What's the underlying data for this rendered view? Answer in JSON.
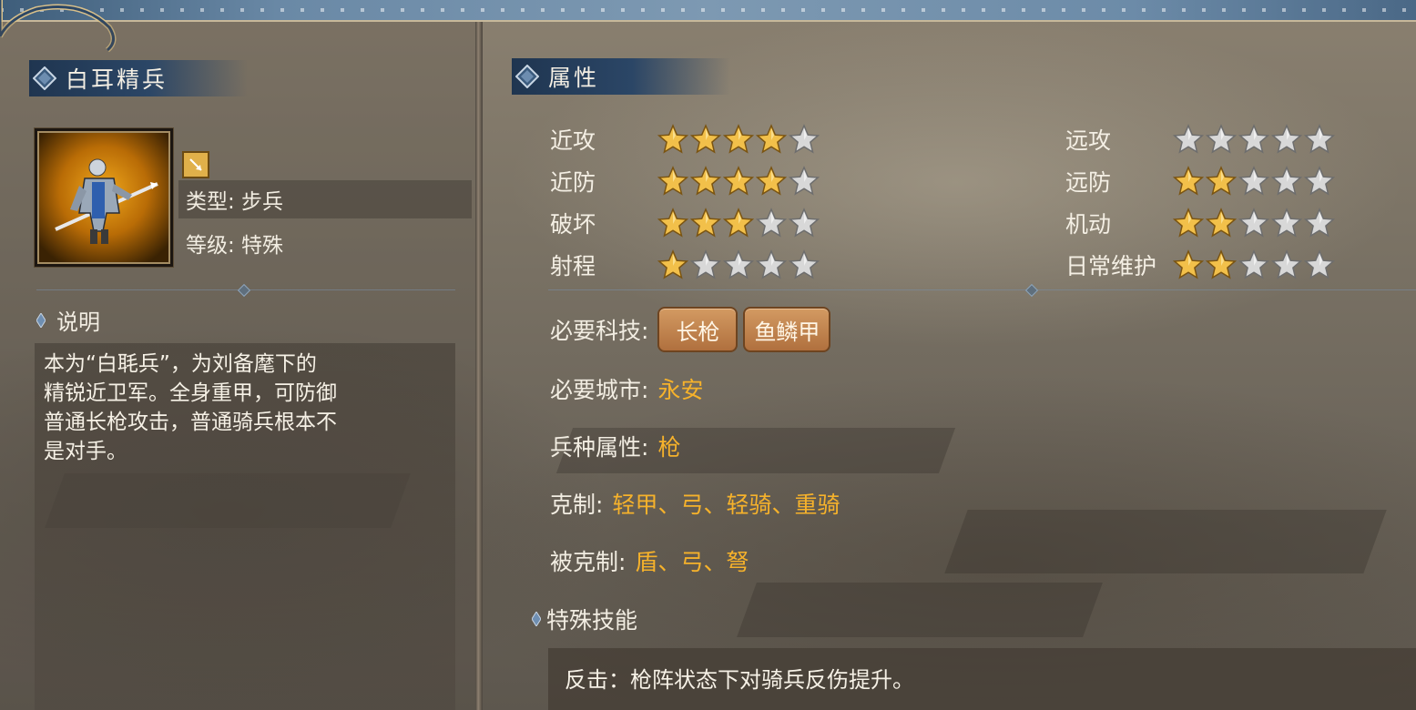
{
  "unit": {
    "name": "白耳精兵",
    "type_label": "类型: 步兵",
    "level_label": "等级: 特殊"
  },
  "description": {
    "heading": "说明",
    "lines": [
      "本为“白毦兵”，为刘备麾下的",
      "精锐近卫军。全身重甲，可防御",
      "普通长枪攻击，普通骑兵根本不",
      "是对手。"
    ]
  },
  "attributes": {
    "heading": "属性",
    "left": [
      {
        "label": "近攻",
        "stars": 4
      },
      {
        "label": "近防",
        "stars": 4
      },
      {
        "label": "破坏",
        "stars": 3
      },
      {
        "label": "射程",
        "stars": 1
      }
    ],
    "right": [
      {
        "label": "远攻",
        "stars": 0
      },
      {
        "label": "远防",
        "stars": 2
      },
      {
        "label": "机动",
        "stars": 2
      },
      {
        "label": "日常维护",
        "stars": 2
      }
    ],
    "max_stars": 5
  },
  "requirements": {
    "tech_label": "必要科技:",
    "techs": [
      "长枪",
      "鱼鳞甲"
    ],
    "city_label": "必要城市:",
    "city": "永安",
    "class_label": "兵种属性:",
    "class": "枪",
    "counters_label": "克制:",
    "counters": "轻甲、弓、轻骑、重骑",
    "countered_by_label": "被克制:",
    "countered_by": "盾、弓、弩"
  },
  "special": {
    "heading": "特殊技能",
    "text": "反击：枪阵状态下对骑兵反伤提升。"
  },
  "colors": {
    "accent_value": "#f6b22b",
    "header_blue": "#2b4666",
    "star_gold": "#f2c04a",
    "star_empty": "#d8d8d8"
  },
  "icons": [
    "diamond-gem-icon",
    "weapon-badge-icon",
    "star-icon"
  ]
}
